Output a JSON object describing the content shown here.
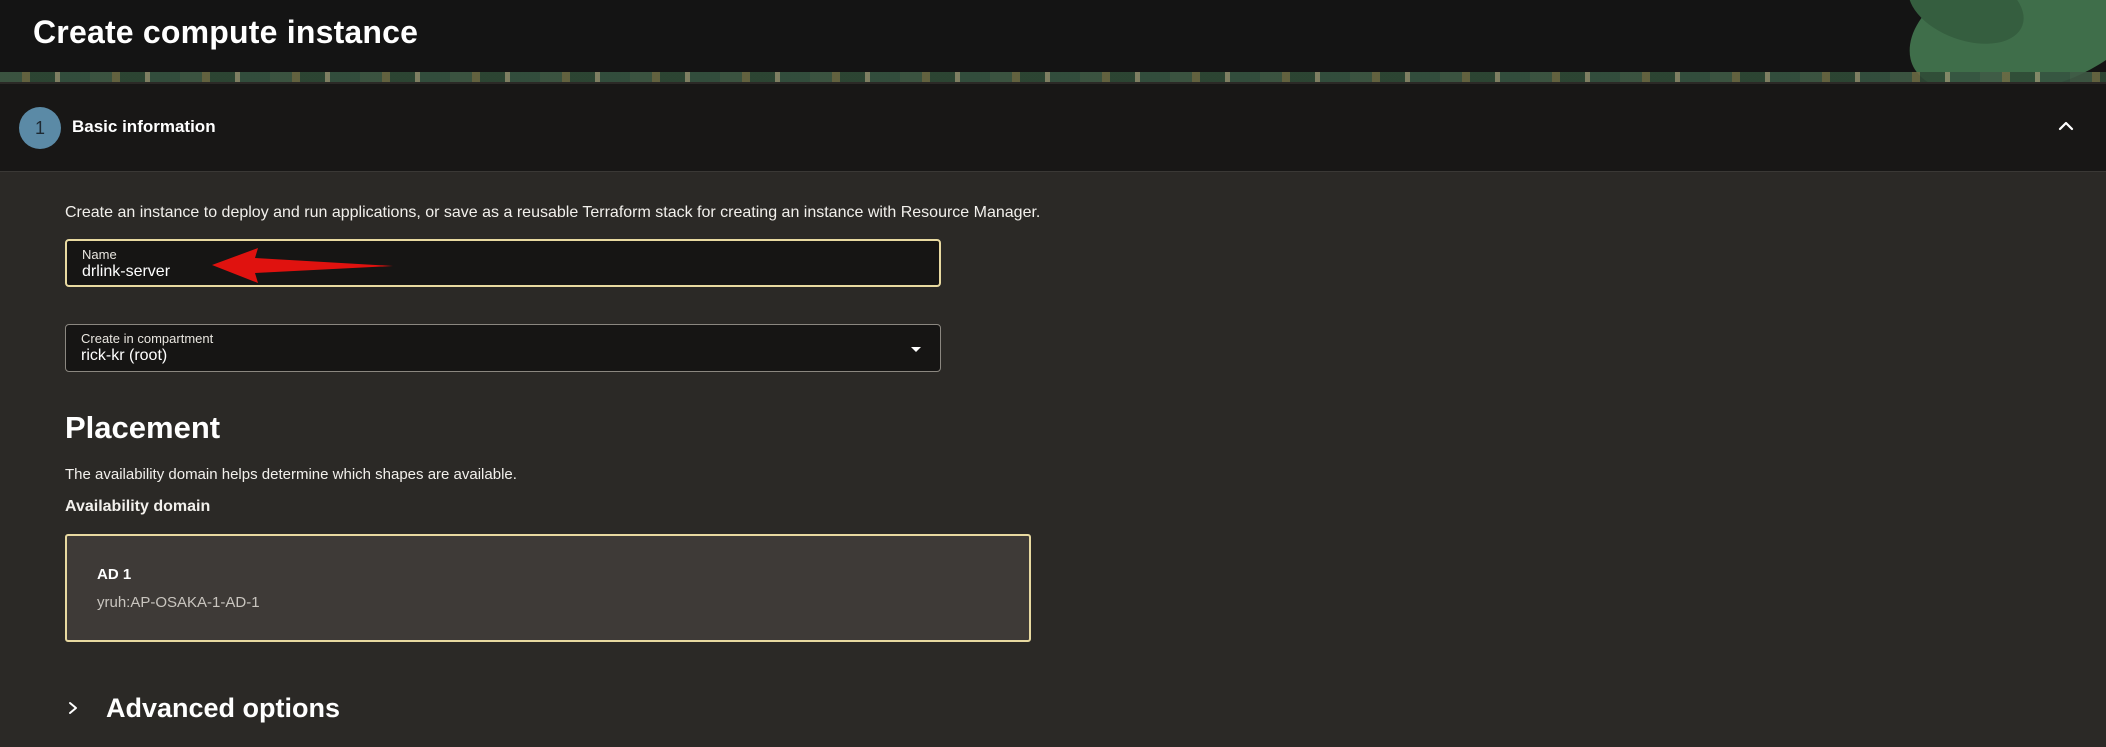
{
  "header": {
    "title": "Create compute instance"
  },
  "section": {
    "step_number": "1",
    "title": "Basic information"
  },
  "intro": "Create an instance to deploy and run applications, or save as a reusable Terraform stack for creating an instance with Resource Manager.",
  "fields": {
    "name": {
      "label": "Name",
      "value": "drlink-server"
    },
    "compartment": {
      "label": "Create in compartment",
      "value": "rick-kr (root)"
    }
  },
  "placement": {
    "title": "Placement",
    "description": "The availability domain helps determine which shapes are available.",
    "ad_label": "Availability domain",
    "ad_card": {
      "name": "AD 1",
      "id": "yruh:AP-OSAKA-1-AD-1"
    }
  },
  "advanced": {
    "label": "Advanced options"
  },
  "colors": {
    "accent_border": "#e8d9a0",
    "annotation_red": "#e0120f",
    "badge": "#5b8aa6"
  }
}
